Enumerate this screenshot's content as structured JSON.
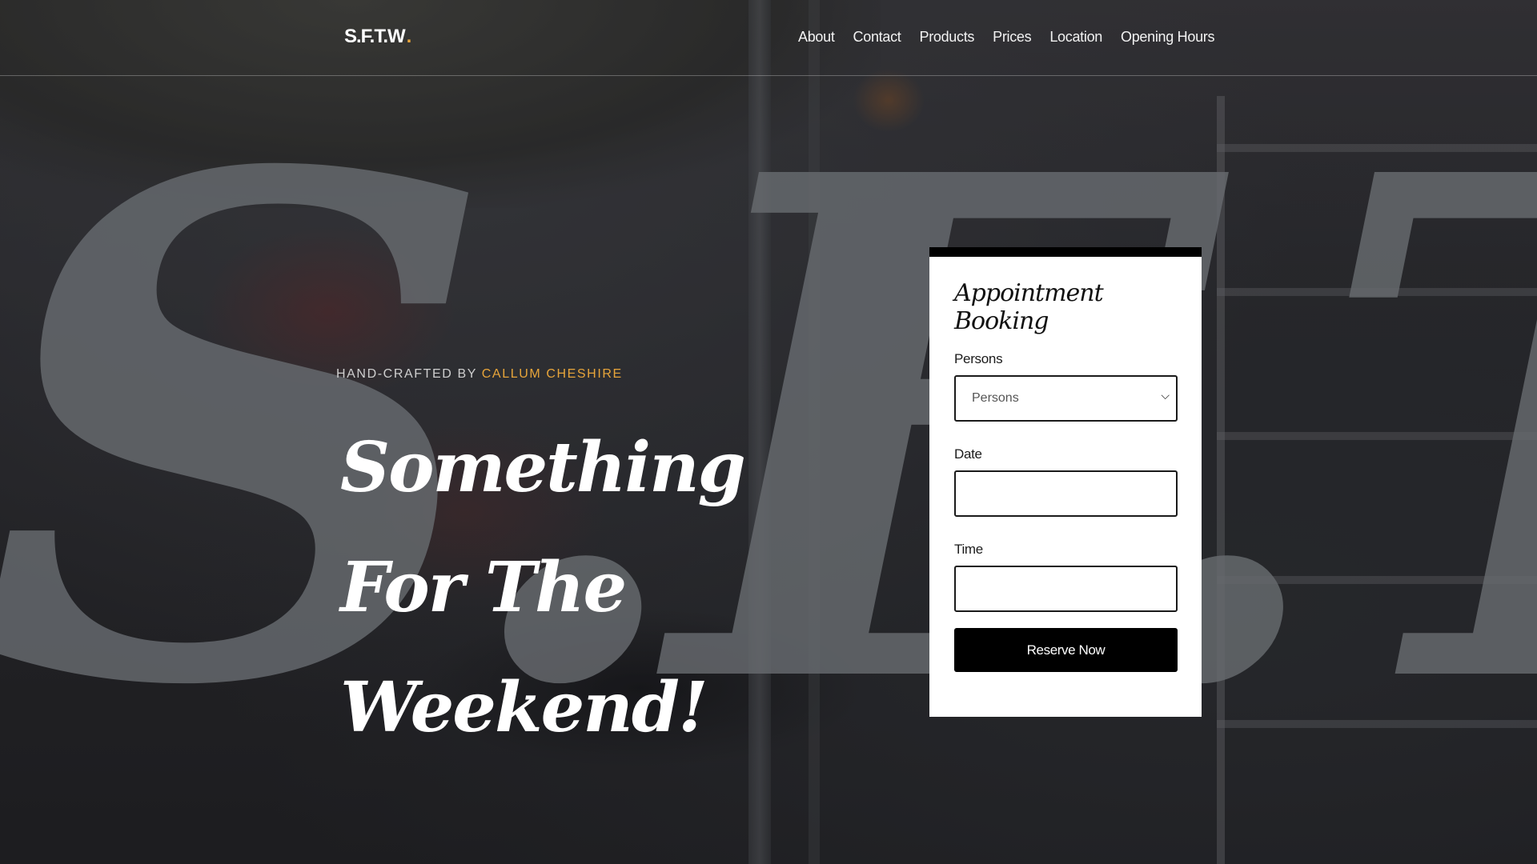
{
  "brand": {
    "name": "S.F.T.W",
    "dot": ".",
    "dot_color": "#e8a53a"
  },
  "nav": {
    "items": [
      {
        "label": "About"
      },
      {
        "label": "Contact"
      },
      {
        "label": "Products"
      },
      {
        "label": "Prices"
      },
      {
        "label": "Location"
      },
      {
        "label": "Opening Hours"
      }
    ]
  },
  "hero": {
    "background_letters": "S.F.T.W",
    "credit_prefix": "HAND-CRAFTED BY",
    "credit_author": "CALLUM CHESHIRE",
    "headline": "Something For The Weekend!"
  },
  "booking": {
    "title": "Appointment Booking",
    "persons_label": "Persons",
    "persons_selected": "Persons",
    "date_label": "Date",
    "date_value": "",
    "time_label": "Time",
    "time_value": "",
    "submit_label": "Reserve Now"
  },
  "colors": {
    "accent": "#e8a53a",
    "card_bg": "#ffffff",
    "button_bg": "#000000"
  }
}
